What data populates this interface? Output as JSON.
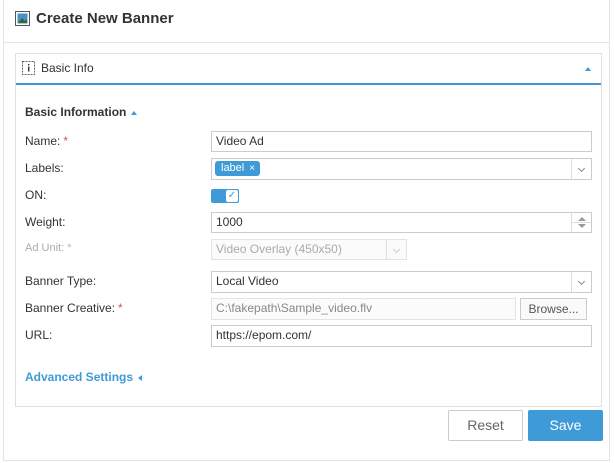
{
  "header": {
    "title": "Create New Banner",
    "icon": "image-icon"
  },
  "panel": {
    "title": "Basic Info",
    "icon": "info-icon"
  },
  "section": {
    "title": "Basic Information"
  },
  "form": {
    "name": {
      "label": "Name:",
      "required": "*",
      "value": "Video Ad"
    },
    "labels": {
      "label": "Labels:",
      "tag": "label",
      "tag_remove": "×"
    },
    "on": {
      "label": "ON:",
      "checked": true
    },
    "weight": {
      "label": "Weight:",
      "value": "1000"
    },
    "ad_unit": {
      "label": "Ad Unit:",
      "required": "*",
      "value": "Video Overlay (450x50)"
    },
    "banner_type": {
      "label": "Banner Type:",
      "value": "Local Video"
    },
    "banner_creative": {
      "label": "Banner Creative:",
      "required": "*",
      "value": "C:\\fakepath\\Sample_video.flv",
      "browse": "Browse..."
    },
    "url": {
      "label": "URL:",
      "value": "https://epom.com/"
    }
  },
  "advanced": {
    "label": "Advanced Settings"
  },
  "buttons": {
    "reset": "Reset",
    "save": "Save"
  },
  "colors": {
    "accent": "#3e9bd8",
    "required": "#d9534f"
  }
}
